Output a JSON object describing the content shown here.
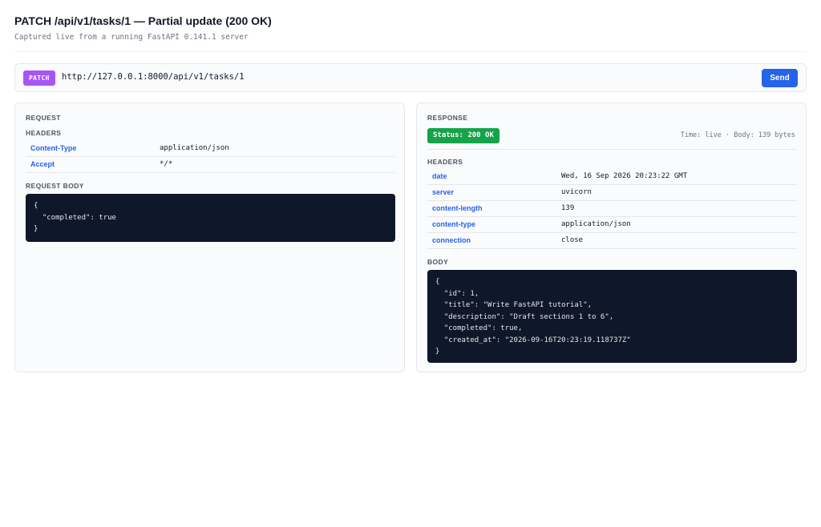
{
  "page": {
    "title": "PATCH /api/v1/tasks/1 — Partial update (200 OK)",
    "subtitle": "Captured live from a running FastAPI 0.141.1 server"
  },
  "url_bar": {
    "method": "PATCH",
    "url": "http://127.0.0.1:8000/api/v1/tasks/1",
    "send_label": "Send"
  },
  "request": {
    "section_label": "REQUEST",
    "headers_label": "HEADERS",
    "headers": [
      {
        "key": "Content-Type",
        "value": "application/json"
      },
      {
        "key": "Accept",
        "value": "*/*"
      }
    ],
    "body_label": "REQUEST BODY",
    "body": "{\n  \"completed\": true\n}"
  },
  "response": {
    "section_label": "RESPONSE",
    "status": "Status: 200 OK",
    "meta": "Time: live · Body: 139 bytes",
    "headers_label": "HEADERS",
    "headers": [
      {
        "key": "date",
        "value": "Wed, 16 Sep 2026 20:23:22 GMT"
      },
      {
        "key": "server",
        "value": "uvicorn"
      },
      {
        "key": "content-length",
        "value": "139"
      },
      {
        "key": "content-type",
        "value": "application/json"
      },
      {
        "key": "connection",
        "value": "close"
      }
    ],
    "body_label": "BODY",
    "body": "{\n  \"id\": 1,\n  \"title\": \"Write FastAPI tutorial\",\n  \"description\": \"Draft sections 1 to 6\",\n  \"completed\": true,\n  \"created_at\": \"2026-09-16T20:23:19.118737Z\"\n}"
  },
  "colors": {
    "method_badge": "#a855f7",
    "send_button": "#2563eb",
    "status_badge": "#16a34a",
    "header_key": "#2563eb",
    "code_background": "#0f172a"
  }
}
